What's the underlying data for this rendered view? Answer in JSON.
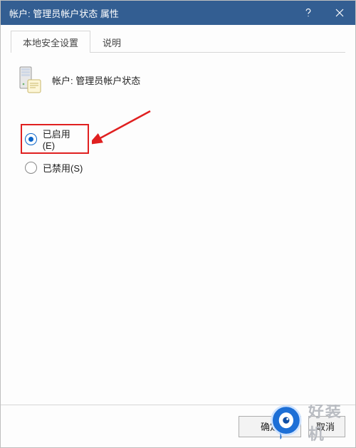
{
  "titlebar": {
    "title": "帐户: 管理员帐户状态 属性"
  },
  "tabs": {
    "items": [
      {
        "label": "本地安全设置",
        "active": true
      },
      {
        "label": "说明",
        "active": false
      }
    ]
  },
  "policy": {
    "header_label": "帐户: 管理员帐户状态"
  },
  "radios": {
    "enabled_label": "已启用(E)",
    "disabled_label": "已禁用(S)",
    "selected": "enabled"
  },
  "buttons": {
    "ok": "确定",
    "cancel": "取消"
  },
  "watermark": {
    "text": "好装机"
  },
  "icons": {
    "help": "help-icon",
    "close": "close-icon",
    "policy": "server-policy-icon",
    "arrow": "red-arrow-icon",
    "bubble": "watermark-bubble-icon"
  }
}
